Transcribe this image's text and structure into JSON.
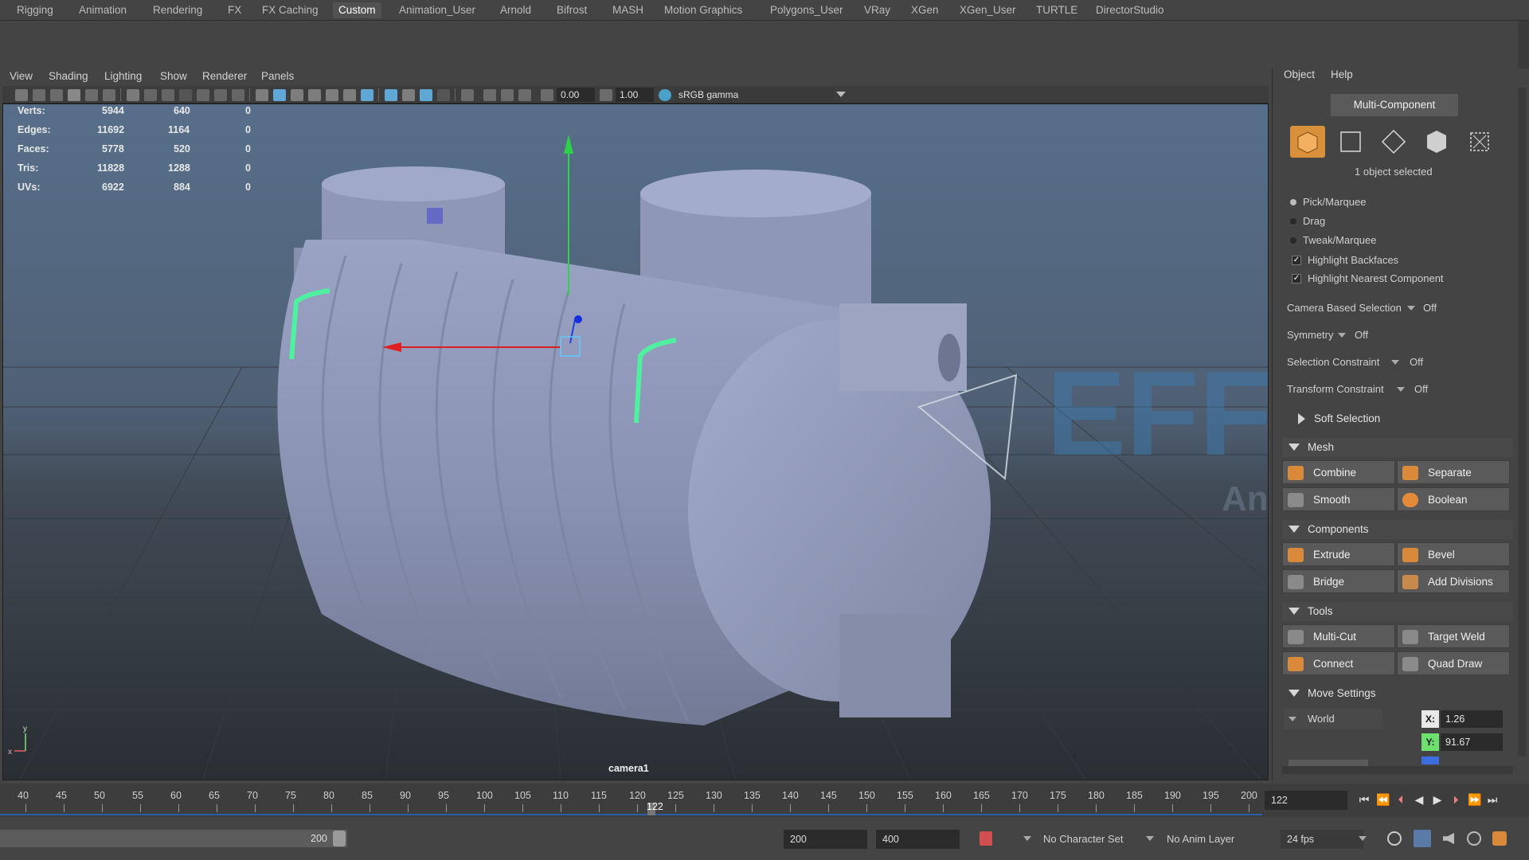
{
  "shelf": {
    "tabs": [
      "Rigging",
      "Animation",
      "Rendering",
      "FX",
      "FX Caching",
      "Custom",
      "Animation_User",
      "Arnold",
      "Bifrost",
      "MASH",
      "Motion Graphics",
      "Polygons_User",
      "VRay",
      "XGen",
      "XGen_User",
      "TURTLE",
      "DirectorStudio"
    ],
    "active": "Custom"
  },
  "viewport": {
    "menus": [
      "View",
      "Shading",
      "Lighting",
      "Show",
      "Renderer",
      "Panels"
    ],
    "exposure": "0.00",
    "gamma": "1.00",
    "color_space": "sRGB gamma",
    "camera_label": "camera1",
    "axis_x": "x",
    "axis_y": "y"
  },
  "hud": {
    "rows": [
      {
        "label": "Verts:",
        "a": "5944",
        "b": "640",
        "c": "0"
      },
      {
        "label": "Edges:",
        "a": "11692",
        "b": "1164",
        "c": "0"
      },
      {
        "label": "Faces:",
        "a": "5778",
        "b": "520",
        "c": "0"
      },
      {
        "label": "Tris:",
        "a": "11828",
        "b": "1288",
        "c": "0"
      },
      {
        "label": "UVs:",
        "a": "6922",
        "b": "884",
        "c": "0"
      }
    ]
  },
  "watermark": {
    "main": "EFFE",
    "sub": "Animation"
  },
  "panel": {
    "menus": [
      "Object",
      "Help"
    ],
    "component_mode": "Multi-Component",
    "selection_status": "1 object selected",
    "pick_options": [
      "Pick/Marquee",
      "Drag",
      "Tweak/Marquee"
    ],
    "checks": [
      "Highlight Backfaces",
      "Highlight Nearest Component"
    ],
    "settings": [
      {
        "label": "Camera Based Selection",
        "value": "Off"
      },
      {
        "label": "Symmetry",
        "value": "Off"
      },
      {
        "label": "Selection Constraint",
        "value": "Off"
      },
      {
        "label": "Transform Constraint",
        "value": "Off"
      }
    ],
    "soft_selection": "Soft Selection",
    "sections": {
      "mesh": "Mesh",
      "components": "Components",
      "tools": "Tools",
      "move_settings": "Move Settings"
    },
    "mesh_buttons": [
      "Combine",
      "Separate",
      "Smooth",
      "Boolean"
    ],
    "component_buttons": [
      "Extrude",
      "Bevel",
      "Bridge",
      "Add Divisions"
    ],
    "tool_buttons": [
      "Multi-Cut",
      "Target Weld",
      "Connect",
      "Quad Draw"
    ],
    "space": "World",
    "coords": {
      "x_label": "X:",
      "x": "1.26",
      "y_label": "Y:",
      "y": "91.67"
    }
  },
  "timeline": {
    "ticks": [
      "40",
      "45",
      "50",
      "55",
      "60",
      "65",
      "70",
      "75",
      "80",
      "85",
      "90",
      "95",
      "100",
      "105",
      "110",
      "115",
      "120",
      "125",
      "130",
      "135",
      "140",
      "145",
      "150",
      "155",
      "160",
      "165",
      "170",
      "175",
      "180",
      "185",
      "190",
      "195",
      "200"
    ],
    "current_frame": "122",
    "current_field": "122"
  },
  "range": {
    "range_end_slider": "200",
    "end_time": "200",
    "max_time": "400",
    "character_set": "No Character Set",
    "anim_layer": "No Anim Layer",
    "fps": "24 fps"
  }
}
